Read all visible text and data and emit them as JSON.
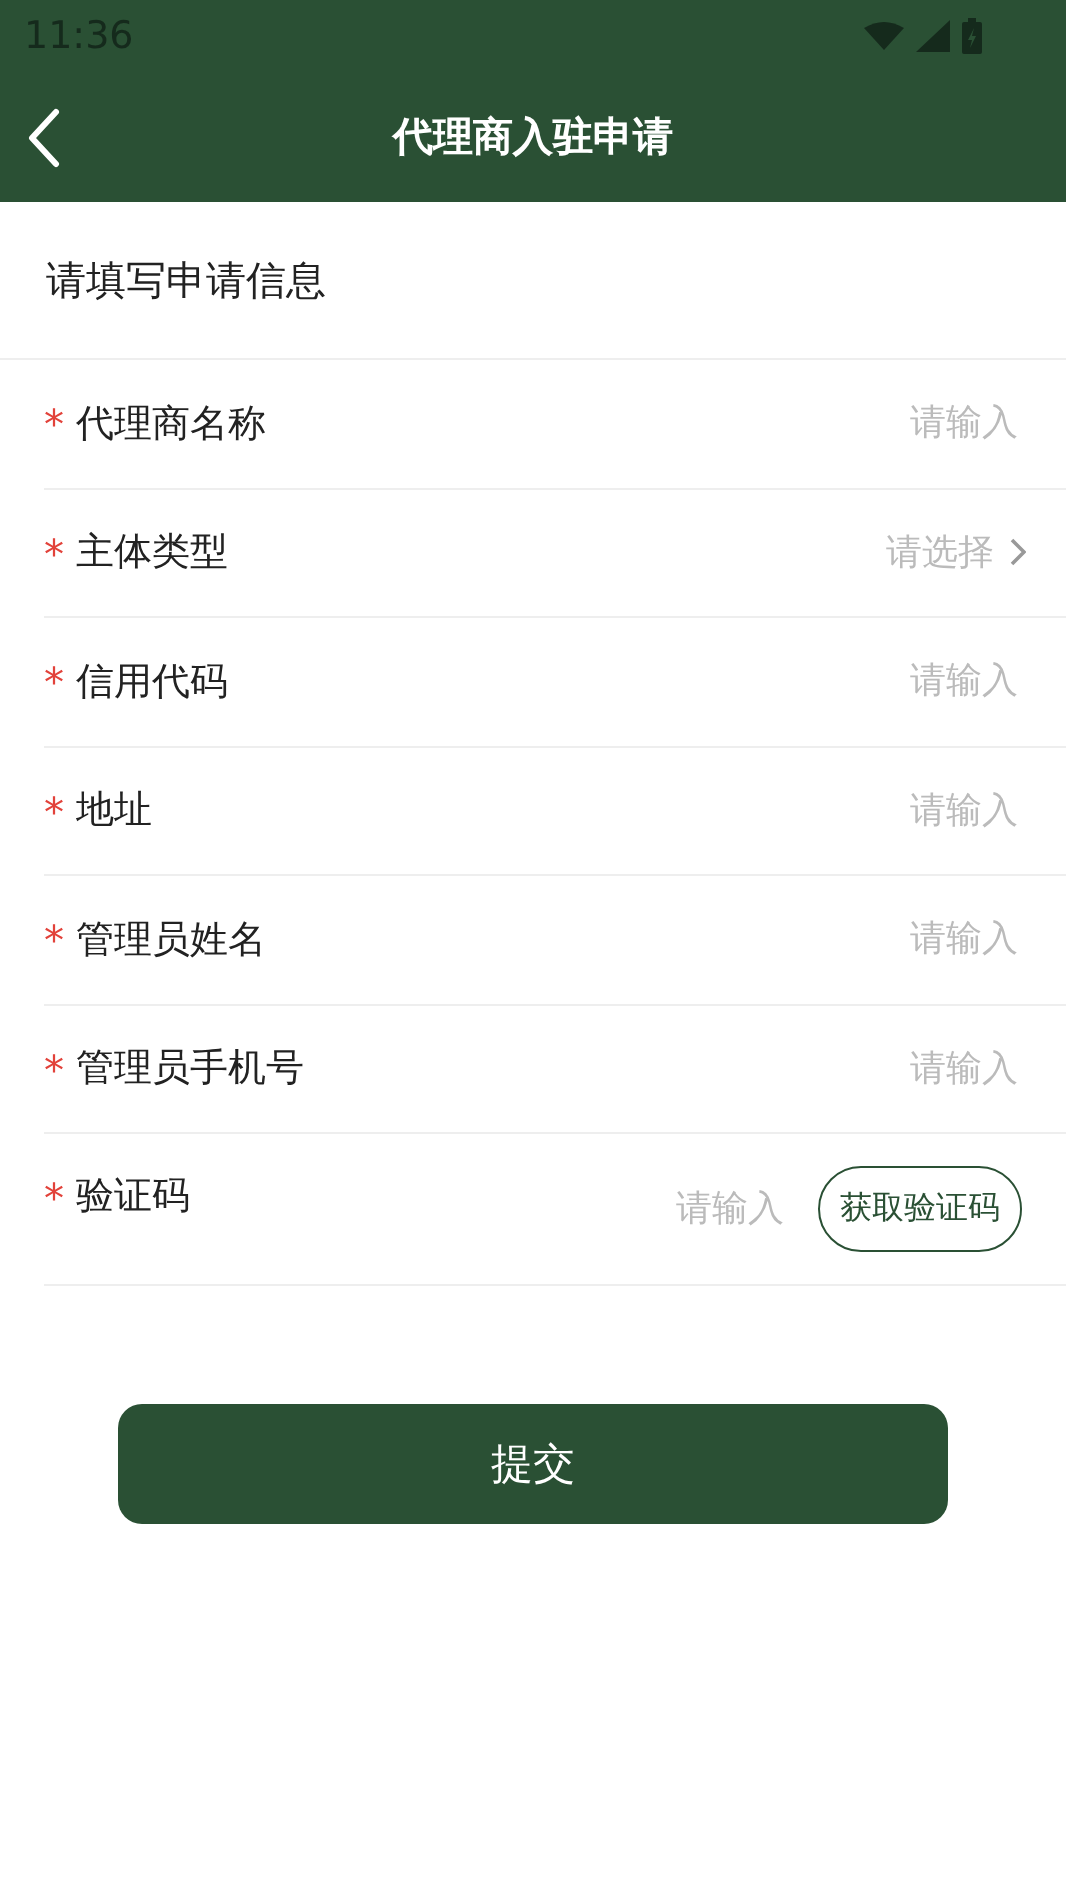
{
  "status_bar": {
    "time": "11:36"
  },
  "nav": {
    "title": "代理商入驻申请"
  },
  "section_title": "请填写申请信息",
  "fields": [
    {
      "kind": "input",
      "required_mark": "*",
      "label": "代理商名称",
      "placeholder": "请输入"
    },
    {
      "kind": "select",
      "required_mark": "*",
      "label": "主体类型",
      "placeholder": "请选择"
    },
    {
      "kind": "input",
      "required_mark": "*",
      "label": "信用代码",
      "placeholder": "请输入"
    },
    {
      "kind": "input",
      "required_mark": "*",
      "label": "地址",
      "placeholder": "请输入"
    },
    {
      "kind": "input",
      "required_mark": "*",
      "label": "管理员姓名",
      "placeholder": "请输入"
    },
    {
      "kind": "input",
      "required_mark": "*",
      "label": "管理员手机号",
      "placeholder": "请输入"
    },
    {
      "kind": "code",
      "required_mark": "*",
      "label": "验证码",
      "placeholder": "请输入",
      "button": "获取验证码"
    }
  ],
  "submit": "提交"
}
